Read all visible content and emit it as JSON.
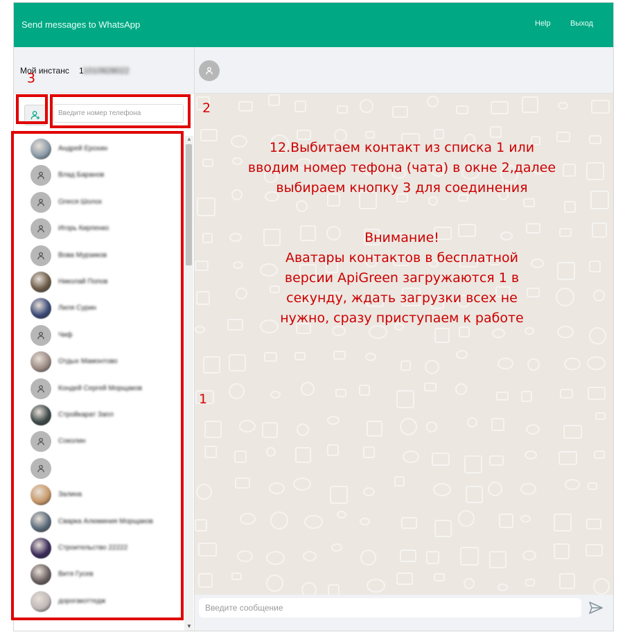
{
  "header": {
    "title": "Send messages to WhatsApp",
    "help": "Help",
    "logout": "Выход"
  },
  "instance": {
    "label": "Мой инстанс",
    "number": "1"
  },
  "search": {
    "placeholder": "Введите номер телефона"
  },
  "contacts": [
    {
      "name": "Андрей Ерохин",
      "avatar": "photo",
      "color": "#8a9aa8"
    },
    {
      "name": "Влад Баранов",
      "avatar": "default"
    },
    {
      "name": "Олеся Шолох",
      "avatar": "default"
    },
    {
      "name": "Игорь Кирпенко",
      "avatar": "default"
    },
    {
      "name": "Вова Мурзиков",
      "avatar": "default"
    },
    {
      "name": "Николай Попов",
      "avatar": "photo",
      "color": "#6b5a48"
    },
    {
      "name": "Лиля Сурин",
      "avatar": "photo",
      "color": "#3a4a78"
    },
    {
      "name": "Чиф",
      "avatar": "default"
    },
    {
      "name": "Отдых Мамонтово",
      "avatar": "photo",
      "color": "#9a8a84"
    },
    {
      "name": "Кондей Сергей Морщаков",
      "avatar": "default"
    },
    {
      "name": "Стройкарат Запл",
      "avatar": "photo",
      "color": "#3e4a4a"
    },
    {
      "name": "Соколин",
      "avatar": "default"
    },
    {
      "name": "",
      "avatar": "default"
    },
    {
      "name": "Залина",
      "avatar": "photo",
      "color": "#c89868"
    },
    {
      "name": "Сварка Алюминия Морщаков",
      "avatar": "photo",
      "color": "#5a6a7a"
    },
    {
      "name": "Строительство 22222",
      "avatar": "photo",
      "color": "#3a2a5a"
    },
    {
      "name": "Витя Гусев",
      "avatar": "photo",
      "color": "#6a6060"
    },
    {
      "name": "дорогакоттедж",
      "avatar": "photo",
      "color": "#c0b8b8"
    }
  ],
  "message": {
    "placeholder": "Введите сообщение"
  },
  "annotations": {
    "label1": "1",
    "label2": "2",
    "label3": "3",
    "text_line1": "12.Выбитаем контакт из списка  1 или",
    "text_line2": "вводим номер тефона (чата) в окне 2,далее",
    "text_line3": "выбираем кнопку 3 для соединения",
    "warn_title": "Внимание!",
    "warn_line1": "Аватары контактов в бесплатной",
    "warn_line2": "версии ApiGreen  загружаются 1 в",
    "warn_line3": "секунду, ждать загрузки всех не",
    "warn_line4": "нужно, сразу приступаем к работе"
  },
  "colors": {
    "header": "#00a884",
    "annotation": "#e00000",
    "chat_bg": "#ece7e1"
  }
}
